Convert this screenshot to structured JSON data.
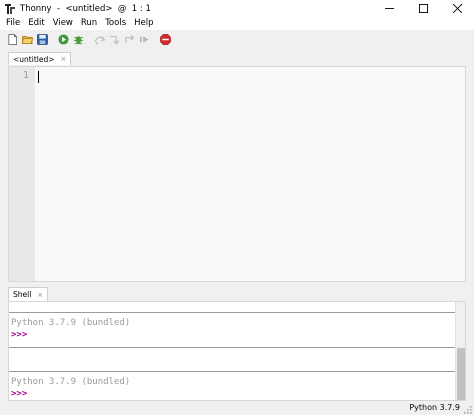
{
  "window": {
    "title": "Thonny  -  <untitled>  @  1 : 1",
    "controls": [
      "minimize-icon",
      "maximize-icon",
      "close-icon"
    ]
  },
  "menu": {
    "items": [
      {
        "label": "File"
      },
      {
        "label": "Edit"
      },
      {
        "label": "View"
      },
      {
        "label": "Run"
      },
      {
        "label": "Tools"
      },
      {
        "label": "Help"
      }
    ]
  },
  "toolbar": {
    "buttons": [
      "new-file-icon",
      "open-folder-icon",
      "save-icon",
      "run-icon",
      "debug-icon",
      "step-over-icon",
      "step-into-icon",
      "step-out-icon",
      "resume-icon",
      "stop-icon"
    ]
  },
  "editor": {
    "tab_label": "<untitled>",
    "tab_close": "×",
    "line_number": "1"
  },
  "shell": {
    "tab_label": "Shell",
    "tab_close": "×",
    "banner_1": "Python 3.7.9 (bundled)",
    "prompt_1": ">>>",
    "banner_2": "Python 3.7.9 (bundled)",
    "prompt_2": ">>>"
  },
  "status": {
    "interpreter": "Python 3.7.9"
  },
  "colors": {
    "prompt": "#a6008f",
    "banner": "#9a9a9a",
    "gutter": "#e9e9e9",
    "editor_bg": "#f9f9f9"
  }
}
